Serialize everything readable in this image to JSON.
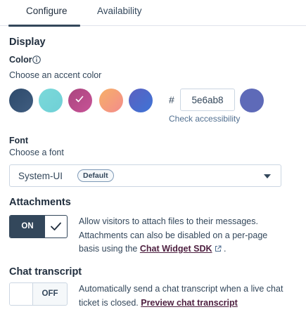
{
  "tabs": [
    {
      "label": "Configure",
      "active": true
    },
    {
      "label": "Availability",
      "active": false
    }
  ],
  "display": {
    "title": "Display",
    "color_label": "Color",
    "color_help": "Choose an accent color",
    "swatches": [
      {
        "name": "dark-blue",
        "color": "#2d4a6b",
        "color2": "#405d80",
        "selected": false
      },
      {
        "name": "aqua",
        "color": "#7bd9da",
        "color2": "#6fd0d6",
        "selected": false
      },
      {
        "name": "magenta",
        "color": "#a9467e",
        "color2": "#c85397",
        "selected": true
      },
      {
        "name": "orange-pink",
        "color": "#f6b067",
        "color2": "#f48c8c",
        "selected": false
      },
      {
        "name": "violet-blue",
        "color": "#5b60c0",
        "color2": "#3e74d6",
        "selected": false
      }
    ],
    "hash": "#",
    "hex_value": "5e6ab8",
    "preview_color": "#5e6ab8",
    "check_accessibility": "Check accessibility"
  },
  "font": {
    "label": "Font",
    "help": "Choose a font",
    "selected": "System-UI",
    "badge": "Default"
  },
  "attachments": {
    "title": "Attachments",
    "toggle_state": "ON",
    "desc_1": "Allow visitors to attach files to their messages. Attachments can also be disabled on a per-page basis using the ",
    "link": "Chat Widget SDK",
    "desc_2": " ."
  },
  "transcript": {
    "title": "Chat transcript",
    "toggle_state": "OFF",
    "desc_1": "Automatically send a chat transcript when a live chat ticket is closed. ",
    "link": "Preview chat transcript"
  },
  "colors": {
    "text": "#33475b",
    "link": "#4d1f3f",
    "border": "#cbd6e2"
  }
}
